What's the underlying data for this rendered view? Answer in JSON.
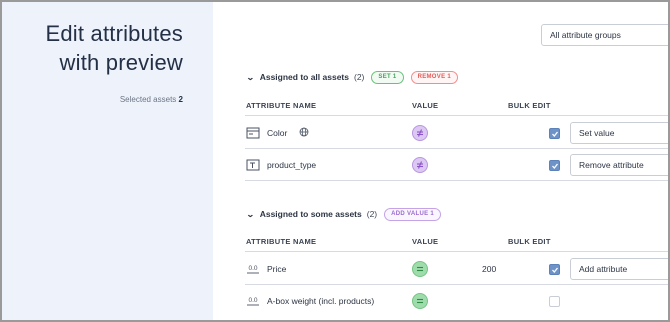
{
  "sidebar": {
    "title": "Edit attributes with preview",
    "selected_label": "Selected assets",
    "selected_count": "2"
  },
  "filter": {
    "attribute_groups": "All attribute groups"
  },
  "columns": {
    "name": "ATTRIBUTE NAME",
    "value": "VALUE",
    "bulk_edit": "BULK EDIT"
  },
  "sections": [
    {
      "title": "Assigned to all assets",
      "count": "(2)",
      "badges": [
        {
          "label": "SET 1",
          "color": "green"
        },
        {
          "label": "REMOVE 1",
          "color": "red"
        }
      ],
      "rows": [
        {
          "name": "Color",
          "icon": "table-icon",
          "value_icon": "mixed-values-icon",
          "value_text": "",
          "checked": true,
          "action": "Set value"
        },
        {
          "name": "product_type",
          "icon": "text-type-icon",
          "value_icon": "mixed-values-icon",
          "value_text": "",
          "checked": true,
          "action": "Remove attribute"
        }
      ]
    },
    {
      "title": "Assigned to some assets",
      "count": "(2)",
      "badges": [
        {
          "label": "ADD VALUE 1",
          "color": "purple"
        }
      ],
      "rows": [
        {
          "name": "Price",
          "icon": "decimal-type-icon",
          "icon_text": "0.0",
          "value_icon": "equal-values-icon",
          "value_text": "200",
          "checked": true,
          "action": "Add attribute"
        },
        {
          "name": "A-box weight (incl. products)",
          "icon": "decimal-type-icon",
          "icon_text": "0.0",
          "value_icon": "equal-values-icon",
          "value_text": "",
          "checked": false,
          "action": ""
        }
      ]
    }
  ],
  "colors": {
    "sidebar_bg": "#eef3fb",
    "checkbox": "#6d93c8",
    "mixed": "#ddc8f3",
    "equal": "#9fdcab"
  }
}
